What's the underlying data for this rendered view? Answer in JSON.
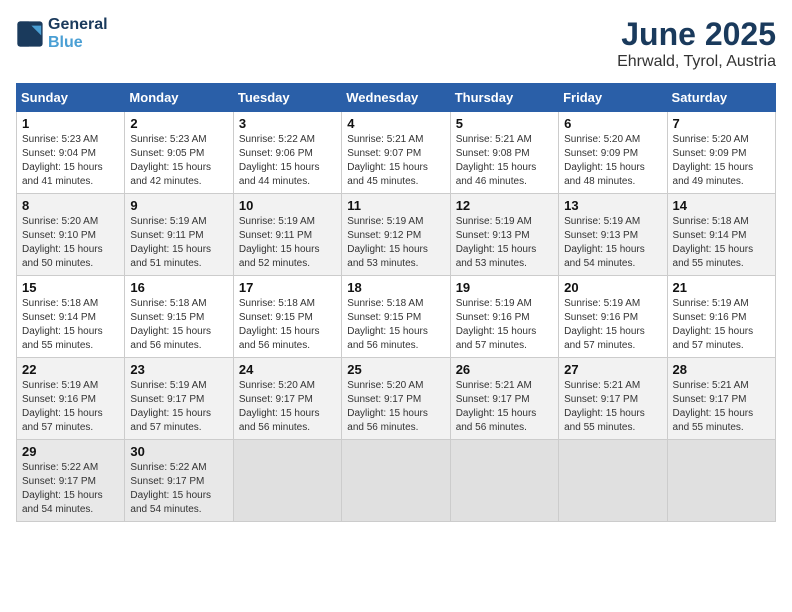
{
  "header": {
    "logo_line1": "General",
    "logo_line2": "Blue",
    "month": "June 2025",
    "location": "Ehrwald, Tyrol, Austria"
  },
  "calendar": {
    "days_of_week": [
      "Sunday",
      "Monday",
      "Tuesday",
      "Wednesday",
      "Thursday",
      "Friday",
      "Saturday"
    ],
    "weeks": [
      [
        {
          "day": "1",
          "info": "Sunrise: 5:23 AM\nSunset: 9:04 PM\nDaylight: 15 hours\nand 41 minutes."
        },
        {
          "day": "2",
          "info": "Sunrise: 5:23 AM\nSunset: 9:05 PM\nDaylight: 15 hours\nand 42 minutes."
        },
        {
          "day": "3",
          "info": "Sunrise: 5:22 AM\nSunset: 9:06 PM\nDaylight: 15 hours\nand 44 minutes."
        },
        {
          "day": "4",
          "info": "Sunrise: 5:21 AM\nSunset: 9:07 PM\nDaylight: 15 hours\nand 45 minutes."
        },
        {
          "day": "5",
          "info": "Sunrise: 5:21 AM\nSunset: 9:08 PM\nDaylight: 15 hours\nand 46 minutes."
        },
        {
          "day": "6",
          "info": "Sunrise: 5:20 AM\nSunset: 9:09 PM\nDaylight: 15 hours\nand 48 minutes."
        },
        {
          "day": "7",
          "info": "Sunrise: 5:20 AM\nSunset: 9:09 PM\nDaylight: 15 hours\nand 49 minutes."
        }
      ],
      [
        {
          "day": "8",
          "info": "Sunrise: 5:20 AM\nSunset: 9:10 PM\nDaylight: 15 hours\nand 50 minutes."
        },
        {
          "day": "9",
          "info": "Sunrise: 5:19 AM\nSunset: 9:11 PM\nDaylight: 15 hours\nand 51 minutes."
        },
        {
          "day": "10",
          "info": "Sunrise: 5:19 AM\nSunset: 9:11 PM\nDaylight: 15 hours\nand 52 minutes."
        },
        {
          "day": "11",
          "info": "Sunrise: 5:19 AM\nSunset: 9:12 PM\nDaylight: 15 hours\nand 53 minutes."
        },
        {
          "day": "12",
          "info": "Sunrise: 5:19 AM\nSunset: 9:13 PM\nDaylight: 15 hours\nand 53 minutes."
        },
        {
          "day": "13",
          "info": "Sunrise: 5:19 AM\nSunset: 9:13 PM\nDaylight: 15 hours\nand 54 minutes."
        },
        {
          "day": "14",
          "info": "Sunrise: 5:18 AM\nSunset: 9:14 PM\nDaylight: 15 hours\nand 55 minutes."
        }
      ],
      [
        {
          "day": "15",
          "info": "Sunrise: 5:18 AM\nSunset: 9:14 PM\nDaylight: 15 hours\nand 55 minutes."
        },
        {
          "day": "16",
          "info": "Sunrise: 5:18 AM\nSunset: 9:15 PM\nDaylight: 15 hours\nand 56 minutes."
        },
        {
          "day": "17",
          "info": "Sunrise: 5:18 AM\nSunset: 9:15 PM\nDaylight: 15 hours\nand 56 minutes."
        },
        {
          "day": "18",
          "info": "Sunrise: 5:18 AM\nSunset: 9:15 PM\nDaylight: 15 hours\nand 56 minutes."
        },
        {
          "day": "19",
          "info": "Sunrise: 5:19 AM\nSunset: 9:16 PM\nDaylight: 15 hours\nand 57 minutes."
        },
        {
          "day": "20",
          "info": "Sunrise: 5:19 AM\nSunset: 9:16 PM\nDaylight: 15 hours\nand 57 minutes."
        },
        {
          "day": "21",
          "info": "Sunrise: 5:19 AM\nSunset: 9:16 PM\nDaylight: 15 hours\nand 57 minutes."
        }
      ],
      [
        {
          "day": "22",
          "info": "Sunrise: 5:19 AM\nSunset: 9:16 PM\nDaylight: 15 hours\nand 57 minutes."
        },
        {
          "day": "23",
          "info": "Sunrise: 5:19 AM\nSunset: 9:17 PM\nDaylight: 15 hours\nand 57 minutes."
        },
        {
          "day": "24",
          "info": "Sunrise: 5:20 AM\nSunset: 9:17 PM\nDaylight: 15 hours\nand 56 minutes."
        },
        {
          "day": "25",
          "info": "Sunrise: 5:20 AM\nSunset: 9:17 PM\nDaylight: 15 hours\nand 56 minutes."
        },
        {
          "day": "26",
          "info": "Sunrise: 5:21 AM\nSunset: 9:17 PM\nDaylight: 15 hours\nand 56 minutes."
        },
        {
          "day": "27",
          "info": "Sunrise: 5:21 AM\nSunset: 9:17 PM\nDaylight: 15 hours\nand 55 minutes."
        },
        {
          "day": "28",
          "info": "Sunrise: 5:21 AM\nSunset: 9:17 PM\nDaylight: 15 hours\nand 55 minutes."
        }
      ],
      [
        {
          "day": "29",
          "info": "Sunrise: 5:22 AM\nSunset: 9:17 PM\nDaylight: 15 hours\nand 54 minutes."
        },
        {
          "day": "30",
          "info": "Sunrise: 5:22 AM\nSunset: 9:17 PM\nDaylight: 15 hours\nand 54 minutes."
        },
        {
          "day": "",
          "info": ""
        },
        {
          "day": "",
          "info": ""
        },
        {
          "day": "",
          "info": ""
        },
        {
          "day": "",
          "info": ""
        },
        {
          "day": "",
          "info": ""
        }
      ]
    ]
  }
}
